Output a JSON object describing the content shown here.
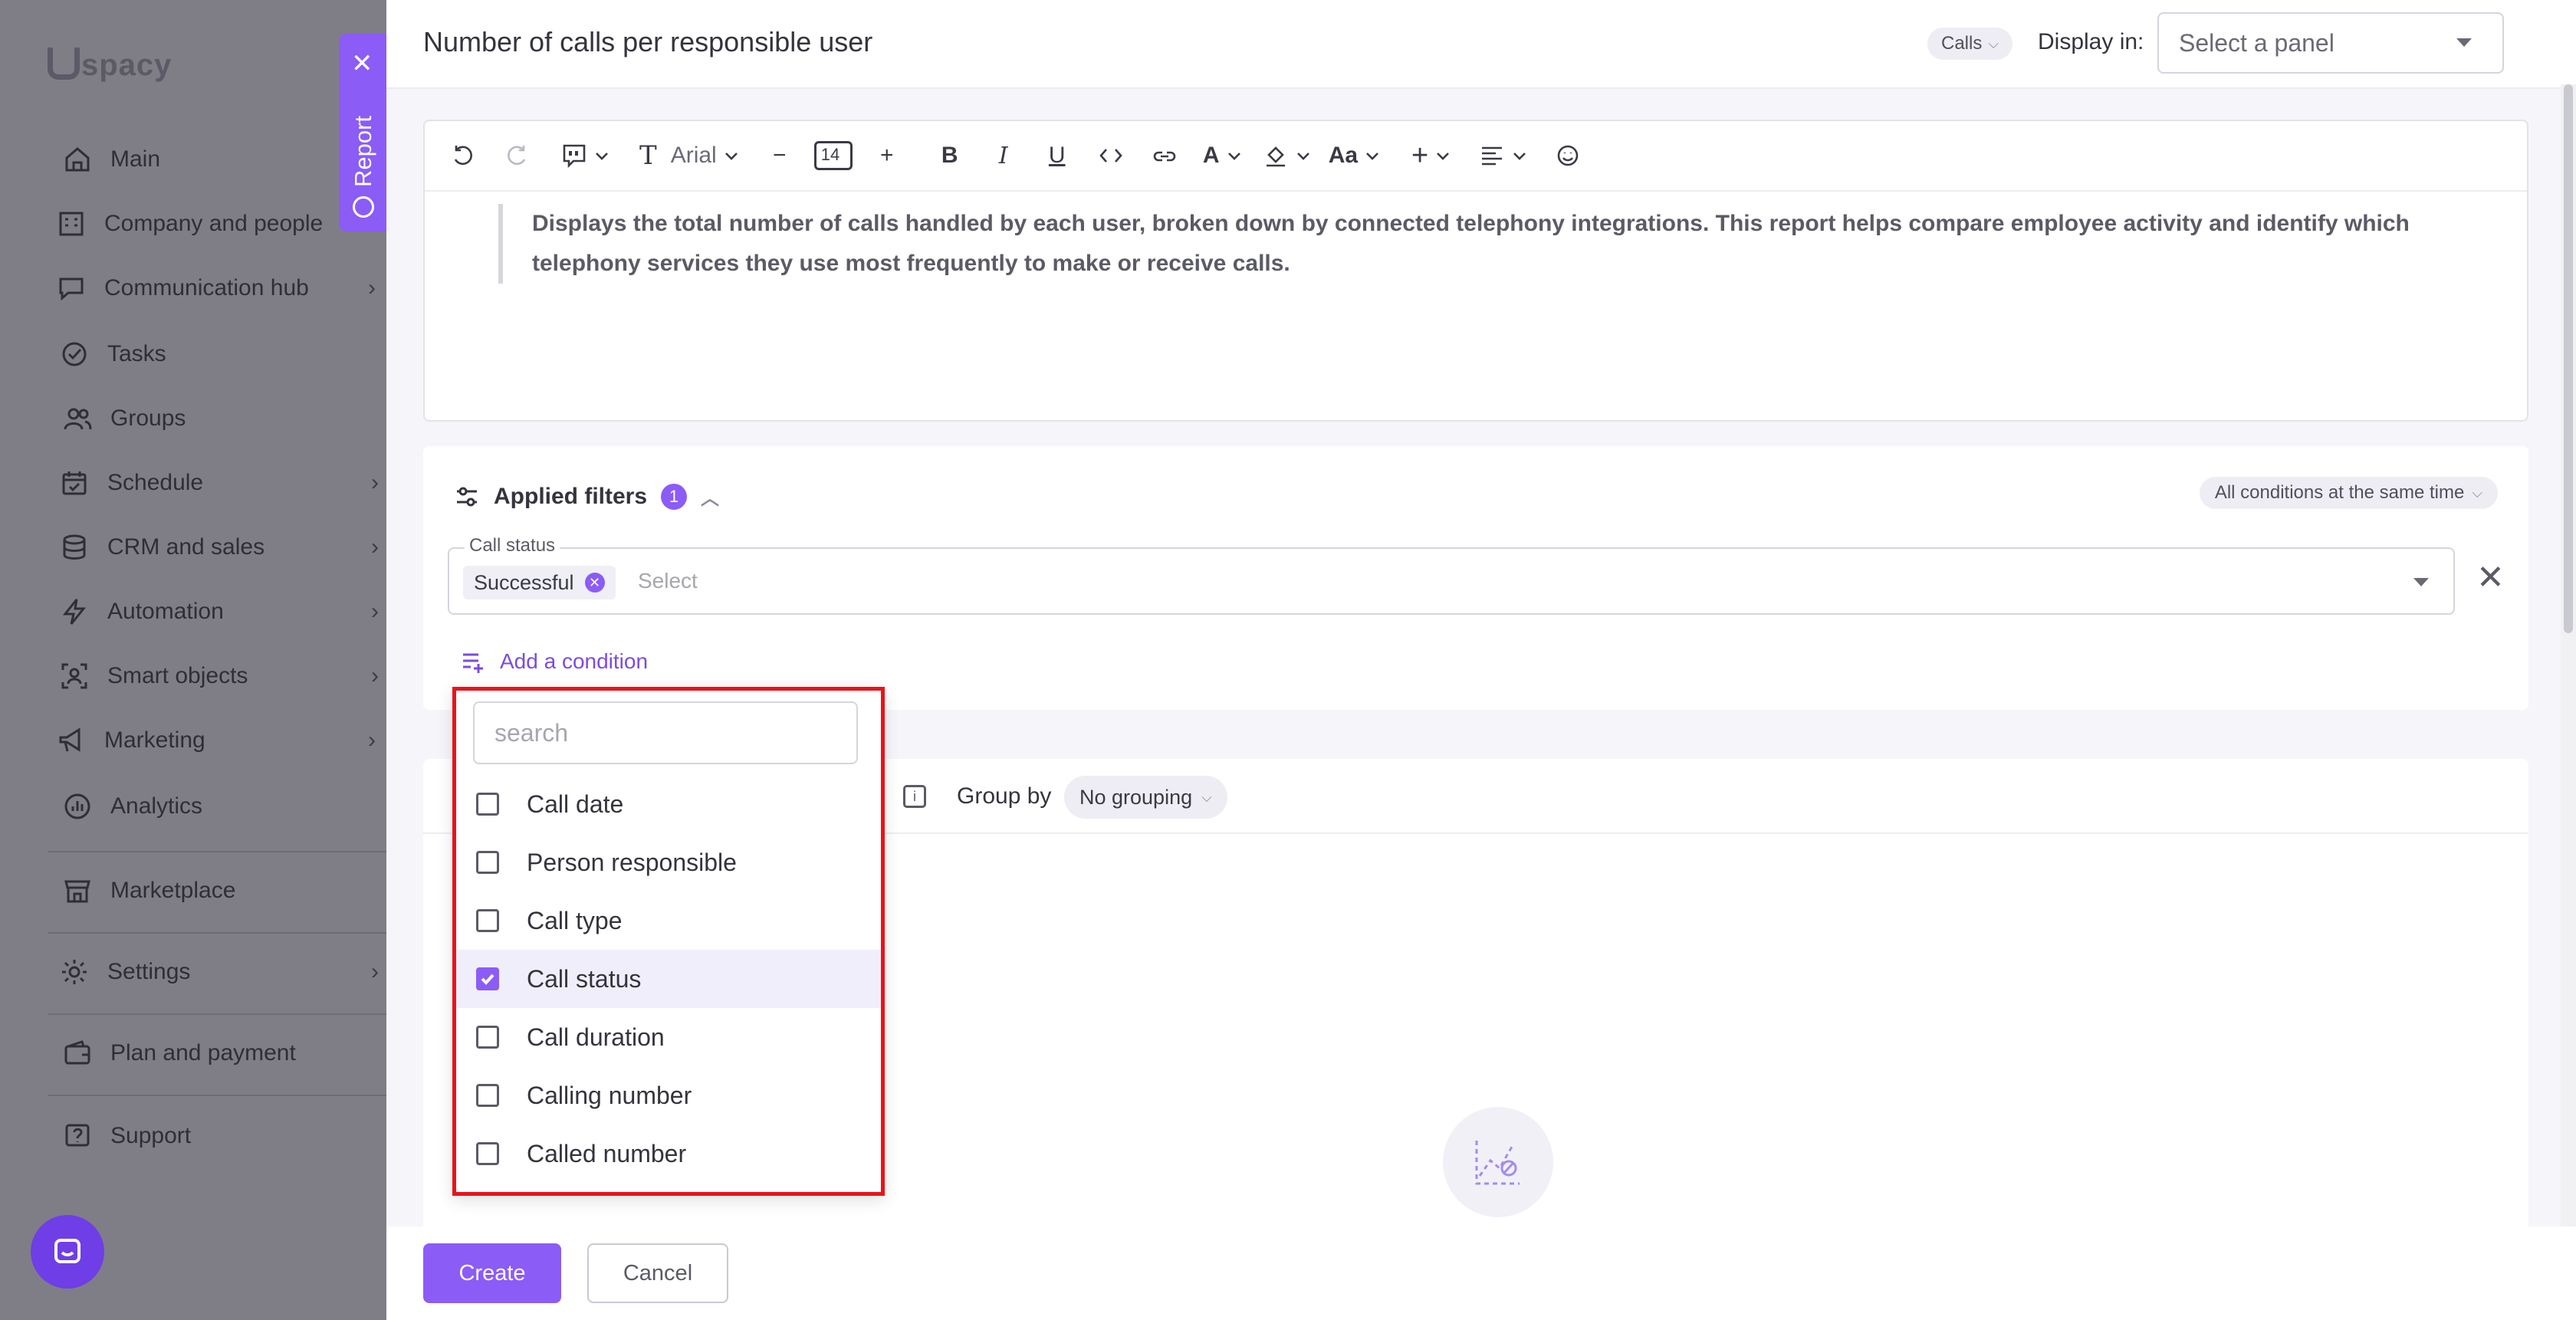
{
  "sidebar": {
    "logo": "spacy",
    "items": [
      {
        "label": "Main",
        "icon": "home-icon"
      },
      {
        "label": "Company and people",
        "icon": "building-icon"
      },
      {
        "label": "Communication hub",
        "icon": "chat-icon"
      },
      {
        "label": "Tasks",
        "icon": "check-circle-icon"
      },
      {
        "label": "Groups",
        "icon": "users-icon"
      },
      {
        "label": "Schedule",
        "icon": "calendar-icon"
      },
      {
        "label": "CRM and sales",
        "icon": "database-icon"
      },
      {
        "label": "Automation",
        "icon": "bolt-icon"
      },
      {
        "label": "Smart objects",
        "icon": "scan-icon"
      },
      {
        "label": "Marketing",
        "icon": "megaphone-icon"
      },
      {
        "label": "Analytics",
        "icon": "chart-icon"
      },
      {
        "label": "Marketplace",
        "icon": "store-icon"
      },
      {
        "label": "Settings",
        "icon": "gear-icon"
      },
      {
        "label": "Plan and payment",
        "icon": "wallet-icon"
      },
      {
        "label": "Support",
        "icon": "help-icon"
      }
    ]
  },
  "report_tab": {
    "label": "Report"
  },
  "header": {
    "title": "Number of calls per responsible user",
    "entity_chip": "Calls",
    "display_in_label": "Display in:",
    "panel_select_placeholder": "Select a panel"
  },
  "editor": {
    "font_name": "Arial",
    "font_size": "14",
    "case_label": "Aa",
    "description": "Displays the total number of calls handled by each user, broken down by connected telephony integrations. This report helps compare employee activity and identify which telephony services they use most frequently to make or receive calls."
  },
  "filters": {
    "title": "Applied filters",
    "count": "1",
    "conditions_mode": "All conditions at the same time",
    "call_status": {
      "legend": "Call status",
      "tag": "Successful",
      "placeholder": "Select"
    },
    "add_condition": "Add a condition"
  },
  "chart_card": {
    "group_by_label": "Group by",
    "group_by_value": "No grouping"
  },
  "footer": {
    "create": "Create",
    "cancel": "Cancel"
  },
  "condition_dropdown": {
    "search_placeholder": "search",
    "options": [
      {
        "label": "Call date",
        "checked": false
      },
      {
        "label": "Person responsible",
        "checked": false
      },
      {
        "label": "Call type",
        "checked": false
      },
      {
        "label": "Call status",
        "checked": true
      },
      {
        "label": "Call duration",
        "checked": false
      },
      {
        "label": "Calling number",
        "checked": false
      },
      {
        "label": "Called number",
        "checked": false
      }
    ]
  },
  "colors": {
    "accent": "#8b5cf6",
    "highlight_border": "#e8141a",
    "overlay": "#7f7e86"
  }
}
